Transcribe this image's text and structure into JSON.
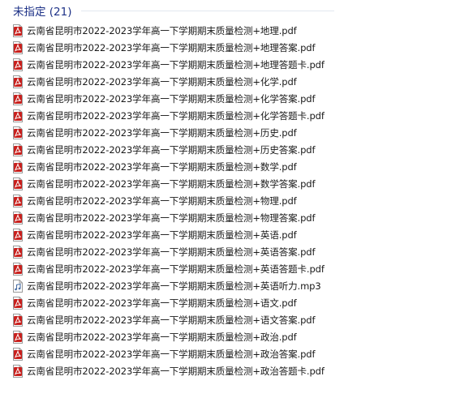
{
  "group": {
    "title": "未指定 (21)"
  },
  "files": [
    {
      "name": "云南省昆明市2022-2023学年高一下学期期末质量检测+地理.pdf",
      "icon": "pdf-file-icon"
    },
    {
      "name": "云南省昆明市2022-2023学年高一下学期期末质量检测+地理答案.pdf",
      "icon": "pdf-file-icon"
    },
    {
      "name": "云南省昆明市2022-2023学年高一下学期期末质量检测+地理答题卡.pdf",
      "icon": "pdf-file-icon"
    },
    {
      "name": "云南省昆明市2022-2023学年高一下学期期末质量检测+化学.pdf",
      "icon": "pdf-file-icon"
    },
    {
      "name": "云南省昆明市2022-2023学年高一下学期期末质量检测+化学答案.pdf",
      "icon": "pdf-file-icon"
    },
    {
      "name": "云南省昆明市2022-2023学年高一下学期期末质量检测+化学答题卡.pdf",
      "icon": "pdf-file-icon"
    },
    {
      "name": "云南省昆明市2022-2023学年高一下学期期末质量检测+历史.pdf",
      "icon": "pdf-file-icon"
    },
    {
      "name": "云南省昆明市2022-2023学年高一下学期期末质量检测+历史答案.pdf",
      "icon": "pdf-file-icon"
    },
    {
      "name": "云南省昆明市2022-2023学年高一下学期期末质量检测+数学.pdf",
      "icon": "pdf-file-icon"
    },
    {
      "name": "云南省昆明市2022-2023学年高一下学期期末质量检测+数学答案.pdf",
      "icon": "pdf-file-icon"
    },
    {
      "name": "云南省昆明市2022-2023学年高一下学期期末质量检测+物理.pdf",
      "icon": "pdf-file-icon"
    },
    {
      "name": "云南省昆明市2022-2023学年高一下学期期末质量检测+物理答案.pdf",
      "icon": "pdf-file-icon"
    },
    {
      "name": "云南省昆明市2022-2023学年高一下学期期末质量检测+英语.pdf",
      "icon": "pdf-file-icon"
    },
    {
      "name": "云南省昆明市2022-2023学年高一下学期期末质量检测+英语答案.pdf",
      "icon": "pdf-file-icon"
    },
    {
      "name": "云南省昆明市2022-2023学年高一下学期期末质量检测+英语答题卡.pdf",
      "icon": "pdf-file-icon"
    },
    {
      "name": "云南省昆明市2022-2023学年高一下学期期末质量检测+英语听力.mp3",
      "icon": "mp3-file-icon"
    },
    {
      "name": "云南省昆明市2022-2023学年高一下学期期末质量检测+语文.pdf",
      "icon": "pdf-file-icon"
    },
    {
      "name": "云南省昆明市2022-2023学年高一下学期期末质量检测+语文答案.pdf",
      "icon": "pdf-file-icon"
    },
    {
      "name": "云南省昆明市2022-2023学年高一下学期期末质量检测+政治.pdf",
      "icon": "pdf-file-icon"
    },
    {
      "name": "云南省昆明市2022-2023学年高一下学期期末质量检测+政治答案.pdf",
      "icon": "pdf-file-icon"
    },
    {
      "name": "云南省昆明市2022-2023学年高一下学期期末质量检测+政治答题卡.pdf",
      "icon": "pdf-file-icon"
    }
  ],
  "colors": {
    "group_header": "#1e3287",
    "pdf_icon": "#c8201d",
    "mp3_icon": "#4a6fa5"
  }
}
